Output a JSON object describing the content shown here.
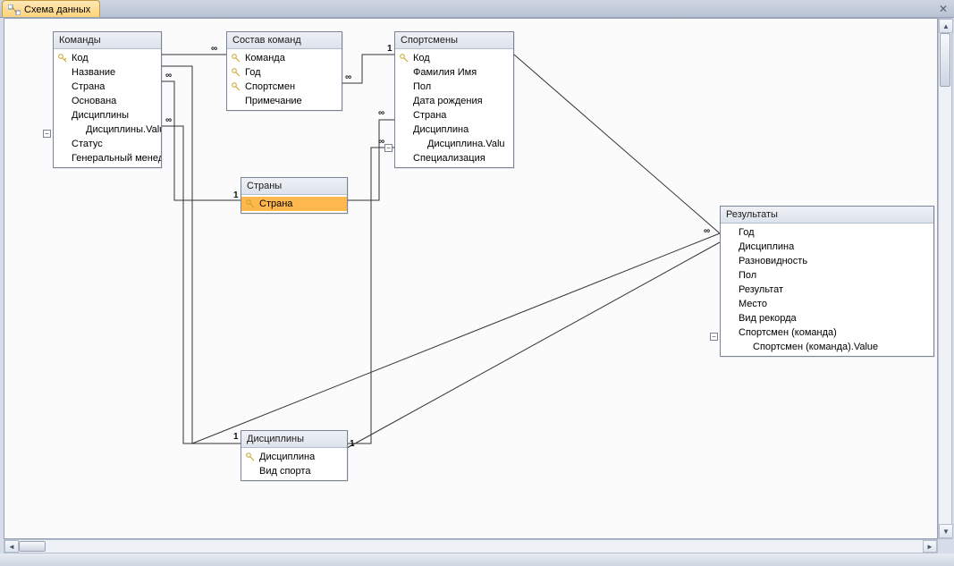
{
  "tab": {
    "title": "Схема данных",
    "icon": "relationships-icon"
  },
  "tables": {
    "teams": {
      "title": "Команды",
      "fields": [
        {
          "label": "Код",
          "key": true
        },
        {
          "label": "Название"
        },
        {
          "label": "Страна"
        },
        {
          "label": "Основана"
        },
        {
          "label": "Дисциплины",
          "expandable": true
        },
        {
          "label": "Дисциплины.Valu",
          "indent": 2
        },
        {
          "label": "Статус"
        },
        {
          "label": "Генеральный менедж"
        }
      ]
    },
    "roster": {
      "title": "Состав команд",
      "fields": [
        {
          "label": "Команда",
          "key": true
        },
        {
          "label": "Год",
          "key": true
        },
        {
          "label": "Спортсмен",
          "key": true
        },
        {
          "label": "Примечание"
        }
      ]
    },
    "athletes": {
      "title": "Спортсмены",
      "fields": [
        {
          "label": "Код",
          "key": true
        },
        {
          "label": "Фамилия Имя"
        },
        {
          "label": "Пол"
        },
        {
          "label": "Дата рождения"
        },
        {
          "label": "Страна"
        },
        {
          "label": "Дисциплина",
          "expandable": true
        },
        {
          "label": "Дисциплина.Valu",
          "indent": 2
        },
        {
          "label": "Специализация"
        }
      ]
    },
    "countries": {
      "title": "Страны",
      "fields": [
        {
          "label": "Страна",
          "key": true,
          "selected": true
        }
      ]
    },
    "disciplines": {
      "title": "Дисциплины",
      "fields": [
        {
          "label": "Дисциплина",
          "key": true
        },
        {
          "label": "Вид спорта"
        }
      ]
    },
    "results": {
      "title": "Результаты",
      "fields": [
        {
          "label": "Год"
        },
        {
          "label": "Дисциплина"
        },
        {
          "label": "Разновидность"
        },
        {
          "label": "Пол"
        },
        {
          "label": "Результат"
        },
        {
          "label": "Место"
        },
        {
          "label": "Вид рекорда"
        },
        {
          "label": "Спортсмен (команда)",
          "expandable": true
        },
        {
          "label": "Спортсмен (команда).Value",
          "indent": 2
        }
      ]
    }
  },
  "relationships": [
    {
      "from": "teams",
      "to": "roster",
      "left": "1",
      "right": "∞"
    },
    {
      "from": "athletes",
      "to": "roster",
      "left": "1",
      "right": "∞"
    },
    {
      "from": "countries",
      "to": "teams",
      "left": "1",
      "right": "∞"
    },
    {
      "from": "countries",
      "to": "athletes",
      "left": "1",
      "right": "∞"
    },
    {
      "from": "disciplines",
      "to": "teams",
      "left": "1",
      "right": "∞"
    },
    {
      "from": "disciplines",
      "to": "athletes",
      "left": "1",
      "right": "∞"
    },
    {
      "from": "disciplines",
      "to": "results",
      "left": "1",
      "right": ""
    },
    {
      "from": "athletes",
      "to": "results",
      "left": "",
      "right": "∞"
    },
    {
      "from": "teams",
      "to": "results",
      "left": "",
      "right": "∞"
    }
  ],
  "symbols": {
    "one": "1",
    "many": "∞",
    "minus": "−"
  }
}
